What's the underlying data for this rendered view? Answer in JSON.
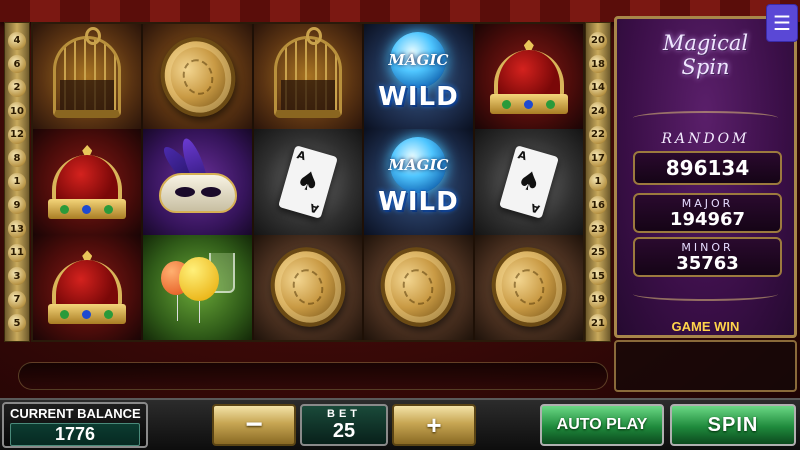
{
  "game": {
    "title_line1": "Magical",
    "title_line2": "Spin"
  },
  "paylines": {
    "left": [
      "4",
      "6",
      "2",
      "10",
      "12",
      "8",
      "1",
      "9",
      "13",
      "11",
      "3",
      "7",
      "5"
    ],
    "right": [
      "20",
      "18",
      "14",
      "24",
      "22",
      "17",
      "1",
      "16",
      "23",
      "25",
      "15",
      "19",
      "21"
    ]
  },
  "reels": [
    [
      "cage",
      "crown",
      "crown"
    ],
    [
      "coin",
      "mask",
      "balloons"
    ],
    [
      "cage",
      "card",
      "coin"
    ],
    [
      "wild",
      "wild",
      "coin"
    ],
    [
      "crown",
      "card",
      "coin"
    ]
  ],
  "wild_symbol": {
    "orb_text": "MAGIC",
    "label": "WILD"
  },
  "card_symbol": {
    "rank": "A",
    "suit": "♠"
  },
  "jackpots": {
    "random_label": "RANDOM",
    "random_value": "896134",
    "major_label": "MAJOR",
    "major_value": "194967",
    "minor_label": "MINOR",
    "minor_value": "35763"
  },
  "game_win_label": "GAME WIN",
  "menu_icon": "☰",
  "balance": {
    "label": "CURRENT BALANCE",
    "value": "1776"
  },
  "bet": {
    "label": "BET",
    "value": "25",
    "minus_label": "−",
    "plus_label": "+"
  },
  "buttons": {
    "auto_play": "AUTO PLAY",
    "spin": "SPIN"
  },
  "colors": {
    "accent_gold": "#c7a653",
    "spin_green": "#1f8a3c",
    "jackpot_purple": "#3b0f48"
  }
}
